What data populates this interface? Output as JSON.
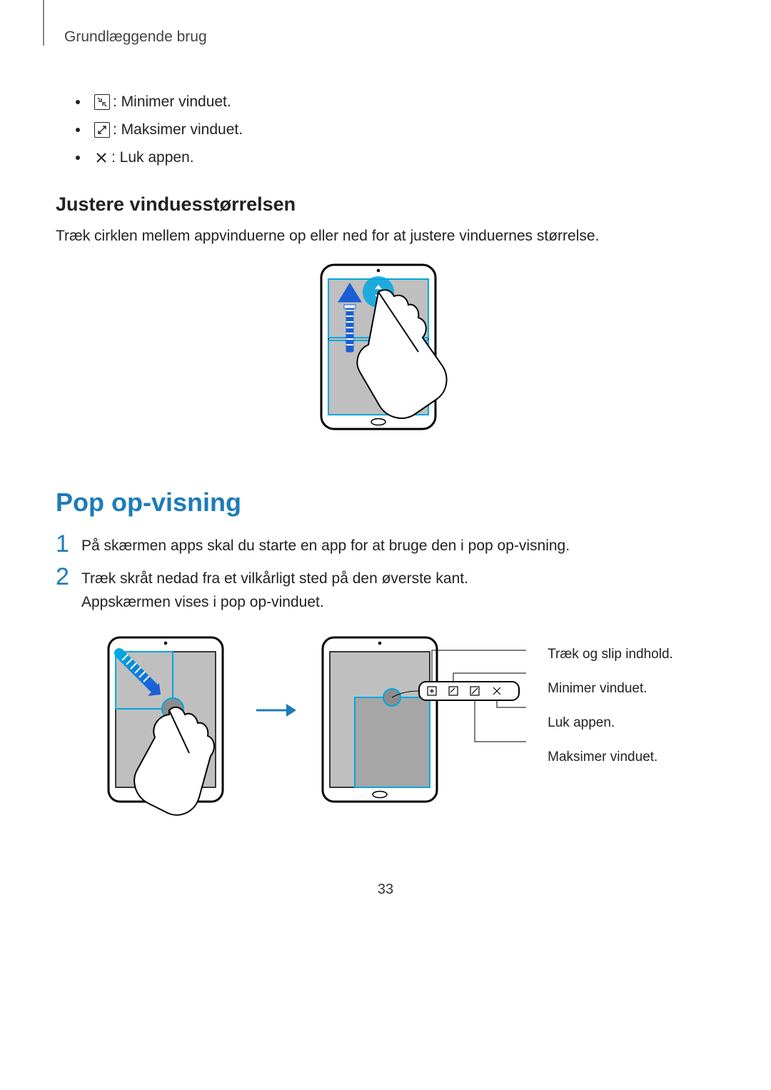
{
  "header": "Grundlæggende brug",
  "bullets": [
    {
      "icon": "minimize-icon",
      "text": ": Minimer vinduet."
    },
    {
      "icon": "maximize-icon",
      "text": ": Maksimer vinduet."
    },
    {
      "icon": "close-icon",
      "text": ": Luk appen."
    }
  ],
  "section1": {
    "heading": "Justere vinduesstørrelsen",
    "body": "Træk cirklen mellem appvinduerne op eller ned for at justere vinduernes størrelse."
  },
  "section2": {
    "heading": "Pop op-visning",
    "steps": [
      "På skærmen apps skal du starte en app for at bruge den i pop op-visning.",
      "Træk skråt nedad fra et vilkårligt sted på den øverste kant.\nAppskærmen vises i pop op-vinduet."
    ]
  },
  "callouts": {
    "c1": "Træk og slip indhold.",
    "c2": "Minimer vinduet.",
    "c3": "Luk appen.",
    "c4": "Maksimer vinduet."
  },
  "pageNumber": "33"
}
